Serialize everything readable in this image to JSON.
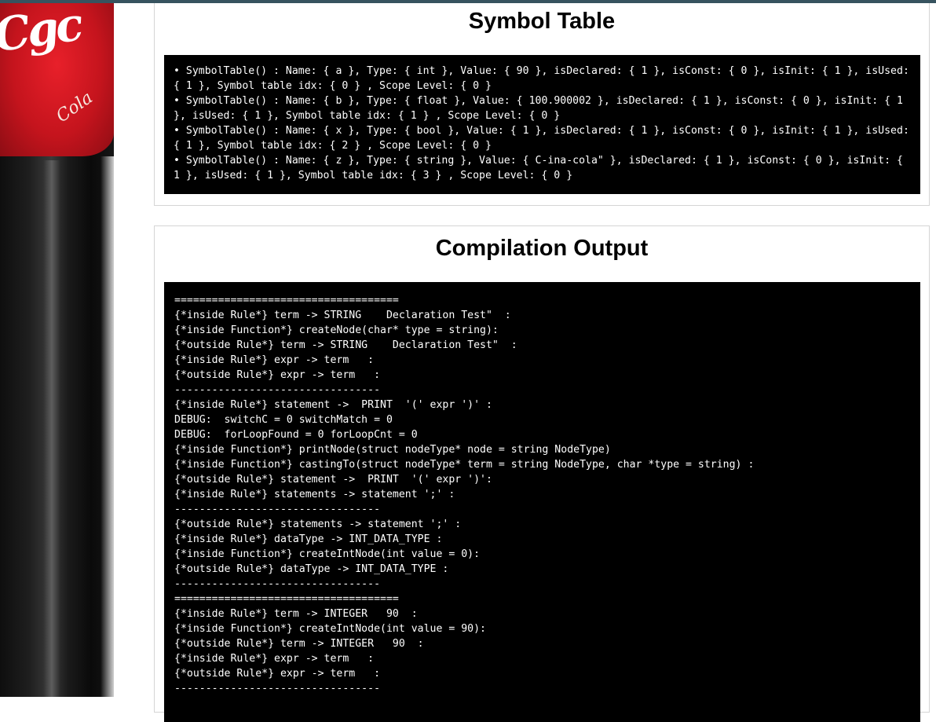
{
  "symbol_table": {
    "title": "Symbol Table",
    "entries": [
      "SymbolTable() : Name: { a }, Type: { int }, Value: { 90 }, isDeclared: { 1 }, isConst: { 0 }, isInit: { 1 }, isUsed: { 1 }, Symbol table idx: { 0 } , Scope Level: { 0 }",
      "SymbolTable() : Name: { b }, Type: { float }, Value: { 100.900002 }, isDeclared: { 1 }, isConst: { 0 }, isInit: { 1 }, isUsed: { 1 }, Symbol table idx: { 1 } , Scope Level: { 0 }",
      "SymbolTable() : Name: { x }, Type: { bool }, Value: { 1 }, isDeclared: { 1 }, isConst: { 0 }, isInit: { 1 }, isUsed: { 1 }, Symbol table idx: { 2 } , Scope Level: { 0 }",
      "SymbolTable() : Name: { z }, Type: { string }, Value: { C-ina-cola\" }, isDeclared: { 1 }, isConst: { 0 }, isInit: { 1 }, isUsed: { 1 }, Symbol table idx: { 3 } , Scope Level: { 0 }"
    ]
  },
  "compilation_output": {
    "title": "Compilation Output",
    "lines": [
      "====================================",
      "{*inside Rule*} term -> STRING    Declaration Test\"  :",
      "{*inside Function*} createNode(char* type = string):",
      "{*outside Rule*} term -> STRING    Declaration Test\"  :",
      "{*inside Rule*} expr -> term   :",
      "{*outside Rule*} expr -> term   :",
      "---------------------------------",
      "{*inside Rule*} statement ->  PRINT  '(' expr ')' :",
      "DEBUG:  switchC = 0 switchMatch = 0",
      "DEBUG:  forLoopFound = 0 forLoopCnt = 0",
      "{*inside Function*} printNode(struct nodeType* node = string NodeType)",
      "{*inside Function*} castingTo(struct nodeType* term = string NodeType, char *type = string) :",
      "{*outside Rule*} statement ->  PRINT  '(' expr ')':",
      "{*inside Rule*} statements -> statement ';' :",
      "---------------------------------",
      "{*outside Rule*} statements -> statement ';' :",
      "{*inside Rule*} dataType -> INT_DATA_TYPE :",
      "{*inside Function*} createIntNode(int value = 0):",
      "{*outside Rule*} dataType -> INT_DATA_TYPE :",
      "---------------------------------",
      "====================================",
      "{*inside Rule*} term -> INTEGER   90  :",
      "{*inside Function*} createIntNode(int value = 90):",
      "{*outside Rule*} term -> INTEGER   90  :",
      "{*inside Rule*} expr -> term   :",
      "{*outside Rule*} expr -> term   :",
      "---------------------------------"
    ]
  }
}
